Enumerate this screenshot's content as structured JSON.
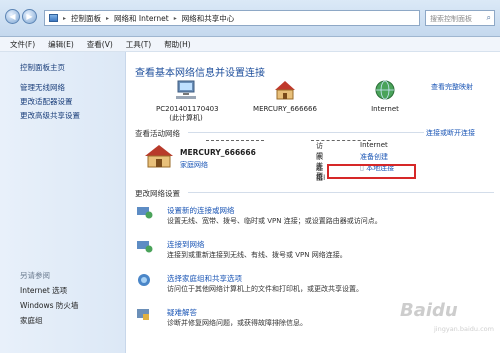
{
  "address": {
    "crumbs": [
      "控制面板",
      "网络和 Internet",
      "网络和共享中心"
    ],
    "search_placeholder": "搜索控制面板"
  },
  "menu": [
    "文件(F)",
    "编辑(E)",
    "查看(V)",
    "工具(T)",
    "帮助(H)"
  ],
  "left": {
    "items": [
      "控制面板主页",
      "管理无线网络",
      "更改适配器设置",
      "更改高级共享设置"
    ],
    "see_also_title": "另请参阅",
    "see_also": [
      "Internet 选项",
      "Windows 防火墙",
      "家庭组"
    ]
  },
  "main": {
    "title": "查看基本网络信息并设置连接",
    "full_map": "查看完整映射",
    "nodes": [
      {
        "name": "PC201401170403",
        "sub": "(此计算机)",
        "icon": "computer-icon"
      },
      {
        "name": "MERCURY_666666",
        "sub": "",
        "icon": "home-network-icon"
      },
      {
        "name": "Internet",
        "sub": "",
        "icon": "globe-icon"
      }
    ],
    "active_header": "查看活动网络",
    "connect_disconnect": "连接或断开连接",
    "active": {
      "name": "MERCURY_666666",
      "type": "家庭网络",
      "props": [
        {
          "k": "访问类型:",
          "v": "Internet",
          "link": false
        },
        {
          "k": "家庭组:",
          "v": "准备创建",
          "link": true
        },
        {
          "k": "连接:",
          "v": "本地连接",
          "link": true
        }
      ]
    },
    "change_header": "更改网络设置",
    "tasks": [
      {
        "title": "设置新的连接或网络",
        "desc": "设置无线、宽带、拨号、临时或 VPN 连接；或设置路由器或访问点。",
        "icon": "new-connection-icon"
      },
      {
        "title": "连接到网络",
        "desc": "连接到或重新连接到无线、有线、拨号或 VPN 网络连接。",
        "icon": "connect-network-icon"
      },
      {
        "title": "选择家庭组和共享选项",
        "desc": "访问位于其他网络计算机上的文件和打印机，或更改共享设置。",
        "icon": "homegroup-icon"
      },
      {
        "title": "疑难解答",
        "desc": "诊断并修复网络问题，或获得故障排除信息。",
        "icon": "troubleshoot-icon"
      }
    ]
  },
  "watermark": "Baidu",
  "watermark_sub": "jingyan.baidu.com"
}
